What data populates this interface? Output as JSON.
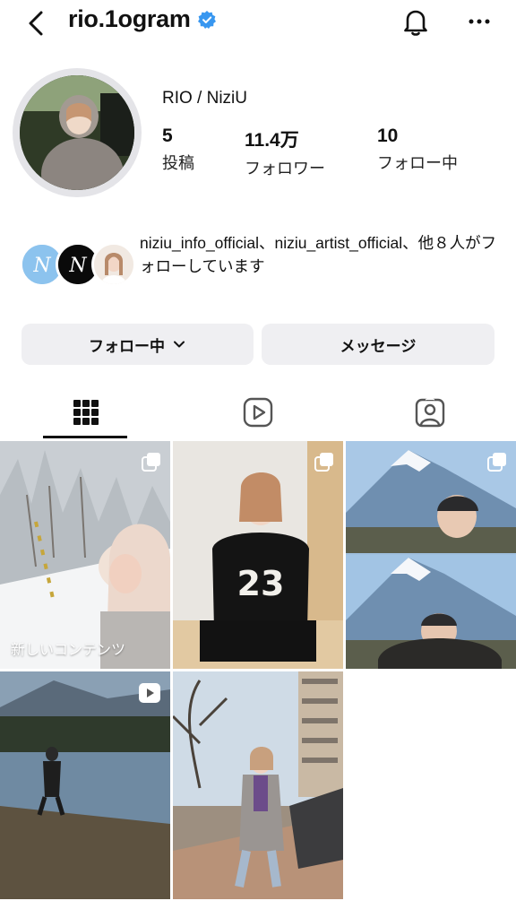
{
  "header": {
    "username": "rio.1ogram"
  },
  "profile": {
    "display_name": "RIO / NiziU",
    "stats": [
      {
        "value": "5",
        "label": "投稿"
      },
      {
        "value": "11.4万",
        "label": "フォロワー"
      },
      {
        "value": "10",
        "label": "フォロー中"
      }
    ]
  },
  "followed_by": {
    "text": "niziu_info_official、niziu_artist_official、他８人がフォローしています"
  },
  "actions": {
    "following_label": "フォロー中",
    "message_label": "メッセージ"
  },
  "tabs": [
    {
      "icon": "grid-icon",
      "active": true
    },
    {
      "icon": "reels-icon",
      "active": false
    },
    {
      "icon": "tagged-icon",
      "active": false
    }
  ],
  "grid": {
    "new_content_label": "新しいコンテンツ"
  },
  "colors": {
    "verified": "#3897f0",
    "button_bg": "#efeff2"
  }
}
